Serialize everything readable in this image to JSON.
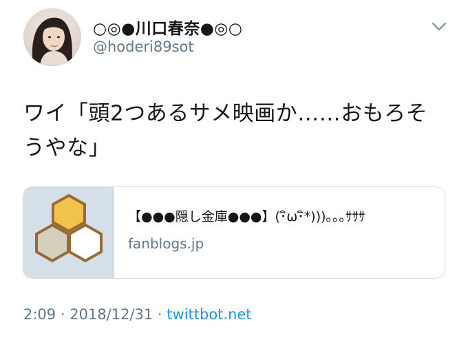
{
  "user": {
    "display_name": "○◎●川口春奈●◎○",
    "handle": "@hoderi89sot"
  },
  "tweet": {
    "text": "ワイ「頭2つあるサメ映画か……おもろそうやな」"
  },
  "card": {
    "title": "【●●●隠し金庫●●●】(･ิω･ิ*)))｡｡｡ｻｻｻ",
    "domain": "fanblogs.jp",
    "thumbnail_icon": "honeycomb-icon"
  },
  "meta": {
    "time": "2:09",
    "separator": " · ",
    "date": "2018/12/31",
    "separator2": " · ",
    "source": "twittbot.net"
  },
  "colors": {
    "text": "#14171a",
    "muted": "#657786",
    "link": "#1b95e0",
    "border": "#d6dde3",
    "honey": "#f0c44c",
    "hex_stroke": "#9a6a34"
  }
}
